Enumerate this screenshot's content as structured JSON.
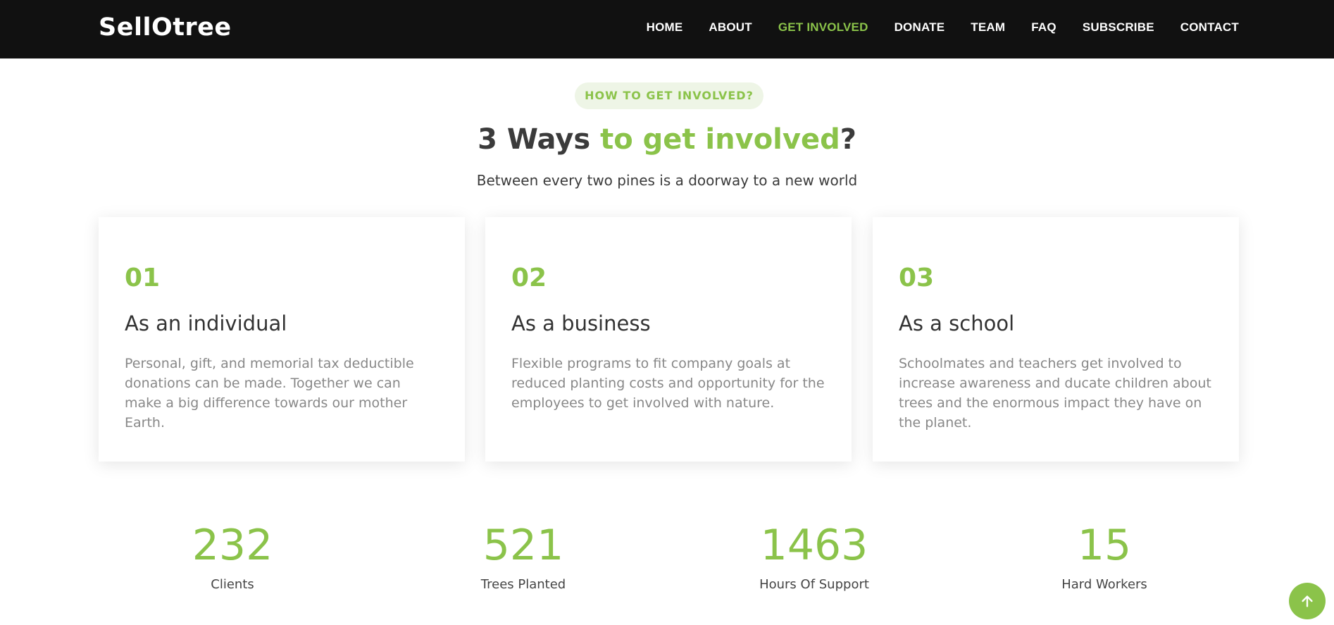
{
  "brand": {
    "name": "SellOtree"
  },
  "nav": {
    "items": [
      {
        "label": "HOME",
        "active": false
      },
      {
        "label": "ABOUT",
        "active": false
      },
      {
        "label": "GET INVOLVED",
        "active": true
      },
      {
        "label": "DONATE",
        "active": false
      },
      {
        "label": "TEAM",
        "active": false
      },
      {
        "label": "FAQ",
        "active": false
      },
      {
        "label": "SUBSCRIBE",
        "active": false
      },
      {
        "label": "CONTACT",
        "active": false
      }
    ]
  },
  "section": {
    "badge": "HOW TO GET INVOLVED?",
    "title_part1": "3 Ways ",
    "title_accent": "to get involved",
    "title_part2": "?",
    "subtitle": "Between every two pines is a doorway to a new world"
  },
  "cards": [
    {
      "number": "01",
      "title": "As an individual",
      "text": "Personal, gift, and memorial tax deductible donations can be made. Together we can make a big difference towards our mother Earth."
    },
    {
      "number": "02",
      "title": "As a business",
      "text": "Flexible programs to fit company goals at reduced planting costs and opportunity for the employees to get involved with nature."
    },
    {
      "number": "03",
      "title": "As a school",
      "text": "Schoolmates and teachers get involved to increase awareness and ducate children about trees and the enormous impact they have on the planet."
    }
  ],
  "stats": [
    {
      "number": "232",
      "label": "Clients"
    },
    {
      "number": "521",
      "label": "Trees Planted"
    },
    {
      "number": "1463",
      "label": "Hours Of Support"
    },
    {
      "number": "15",
      "label": "Hard Workers"
    }
  ],
  "back_to_top": {
    "icon": "arrow-up-icon"
  },
  "colors": {
    "accent": "#8bc34a",
    "navbar_bg": "#111111",
    "badge_bg": "#eef5e6",
    "heading": "#3b3b3b",
    "muted_text": "#888888"
  }
}
